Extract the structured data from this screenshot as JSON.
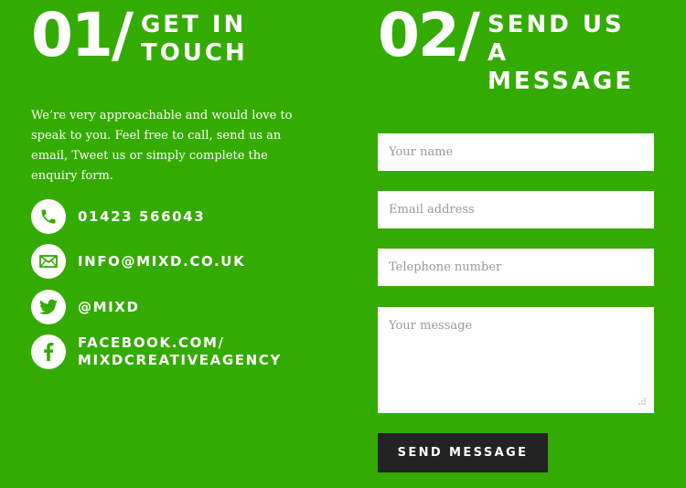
{
  "section1": {
    "number": "01/",
    "title_line1": "GET IN",
    "title_line2": "TOUCH",
    "intro": "We’re very approachable and would love to speak to you. Feel free to call, send us an email, Tweet us or simply complete the enquiry form."
  },
  "contacts": {
    "phone": "01423 566043",
    "email": "INFO@MIXD.CO.UK",
    "twitter": "@MIXD",
    "facebook_line1": "FACEBOOK.COM/",
    "facebook_line2": "MIXDCREATIVEAGENCY"
  },
  "section2": {
    "number": "02/",
    "title_line1": "SEND US",
    "title_line2": "A",
    "title_line3": "MESSAGE"
  },
  "form": {
    "name_placeholder": "Your name",
    "email_placeholder": "Email address",
    "phone_placeholder": "Telephone number",
    "message_placeholder": "Your message",
    "submit_label": "SEND MESSAGE"
  },
  "icons": {
    "phone": "phone-icon",
    "email": "envelope-icon",
    "twitter": "twitter-icon",
    "facebook": "facebook-icon"
  },
  "colors": {
    "background": "#34ab00",
    "button": "#232323",
    "field": "#ffffff"
  }
}
